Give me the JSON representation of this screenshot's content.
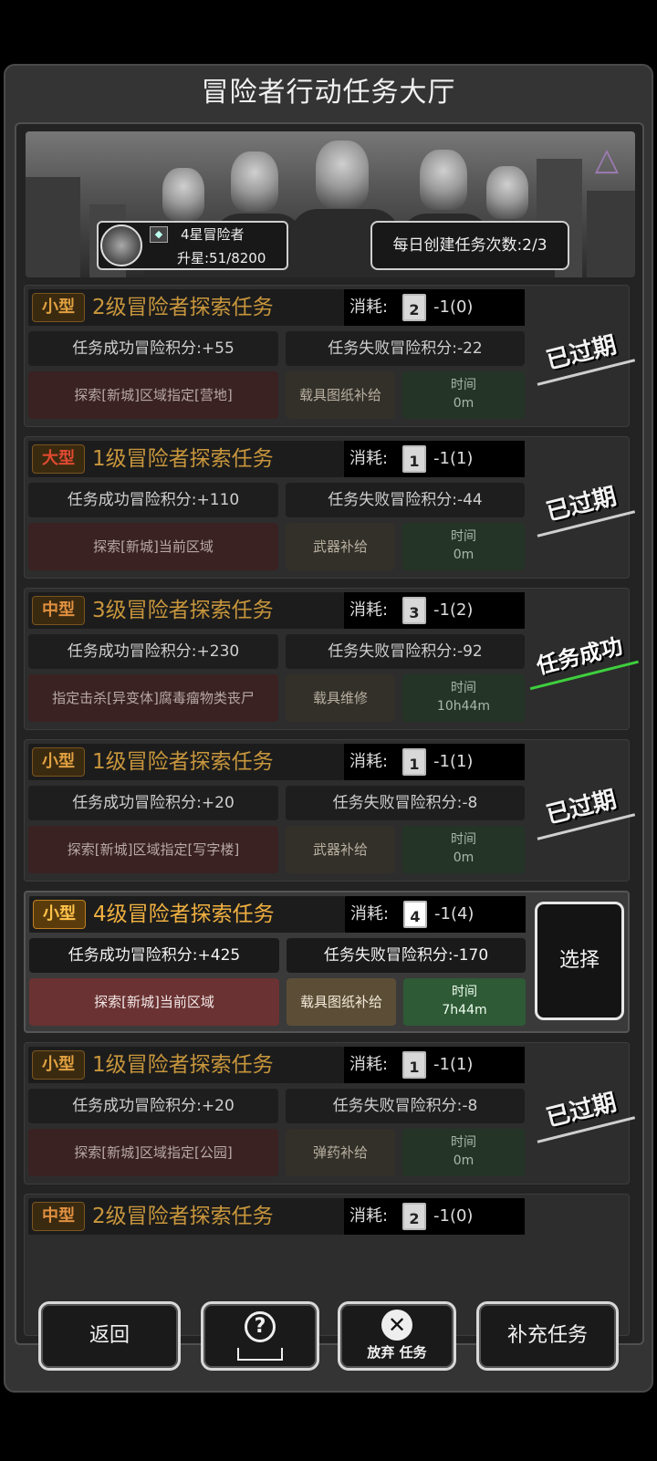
{
  "title": "冒险者行动任务大厅",
  "player": {
    "rank": "4星冒险者",
    "upstar": "升星:51/8200"
  },
  "daily": "每日创建任务次数:2/3",
  "cost_label": "消耗:",
  "time_label": "时间",
  "tasks": [
    {
      "size": "小型",
      "name": "2级冒险者探索任务",
      "lv": "2",
      "cost": "-1(0)",
      "success": "任务成功冒险积分:+55",
      "fail": "任务失败冒险积分:-22",
      "location": "探索[新城]区域指定[营地]",
      "supply": "载具图纸补给",
      "time": "0m",
      "status": "已过期"
    },
    {
      "size": "大型",
      "name": "1级冒险者探索任务",
      "lv": "1",
      "cost": "-1(1)",
      "success": "任务成功冒险积分:+110",
      "fail": "任务失败冒险积分:-44",
      "location": "探索[新城]当前区域",
      "supply": "武器补给",
      "time": "0m",
      "status": "已过期"
    },
    {
      "size": "中型",
      "name": "3级冒险者探索任务",
      "lv": "3",
      "cost": "-1(2)",
      "success": "任务成功冒险积分:+230",
      "fail": "任务失败冒险积分:-92",
      "location": "指定击杀[异变体]腐毒瘤物类丧尸",
      "supply": "载具维修",
      "time": "10h44m",
      "status": "任务成功"
    },
    {
      "size": "小型",
      "name": "1级冒险者探索任务",
      "lv": "1",
      "cost": "-1(1)",
      "success": "任务成功冒险积分:+20",
      "fail": "任务失败冒险积分:-8",
      "location": "探索[新城]区域指定[写字楼]",
      "supply": "武器补给",
      "time": "0m",
      "status": "已过期"
    },
    {
      "size": "小型",
      "name": "4级冒险者探索任务",
      "lv": "4",
      "cost": "-1(4)",
      "success": "任务成功冒险积分:+425",
      "fail": "任务失败冒险积分:-170",
      "location": "探索[新城]当前区域",
      "supply": "载具图纸补给",
      "time": "7h44m",
      "action": "选择"
    },
    {
      "size": "小型",
      "name": "1级冒险者探索任务",
      "lv": "1",
      "cost": "-1(1)",
      "success": "任务成功冒险积分:+20",
      "fail": "任务失败冒险积分:-8",
      "location": "探索[新城]区域指定[公园]",
      "supply": "弹药补给",
      "time": "0m",
      "status": "已过期"
    },
    {
      "size": "中型",
      "name": "2级冒险者探索任务",
      "lv": "2",
      "cost": "-1(0)"
    }
  ],
  "buttons": {
    "back": "返回",
    "help": "?",
    "abandon_a": "放弃",
    "abandon_b": "任务",
    "supply": "补充任务"
  },
  "icons": {
    "help": "question-icon",
    "abandon": "close-icon"
  }
}
